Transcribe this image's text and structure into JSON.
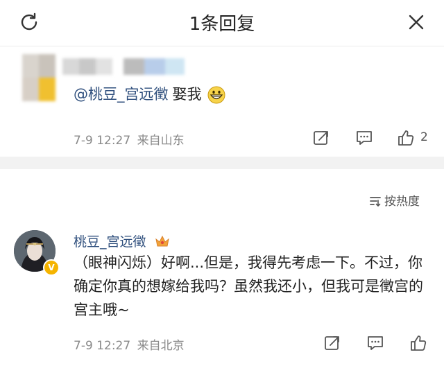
{
  "header": {
    "title": "1条回复",
    "refresh_icon": "refresh-icon",
    "close_icon": "close-icon"
  },
  "original_comment": {
    "mention": "@桃豆_宫远徵",
    "text": "娶我",
    "emoji": "grinning-face-emoji",
    "date": "7-9",
    "time": "12:27",
    "location": "来自山东",
    "like_count": "2"
  },
  "sort": {
    "label": "按热度"
  },
  "reply": {
    "author": "桃豆_宫远徵",
    "text": "（眼神闪烁）好啊...但是，我得先考虑一下。不过，你确定你真的想嫁给我吗？虽然我还小，但我可是徵宫的宫主哦~",
    "date": "7-9",
    "time": "12:27",
    "location": "来自北京"
  },
  "colors": {
    "link": "#2f4f7d",
    "meta": "#8a8a8a",
    "divider": "#f2f2f2",
    "badge": "#f5b400"
  }
}
